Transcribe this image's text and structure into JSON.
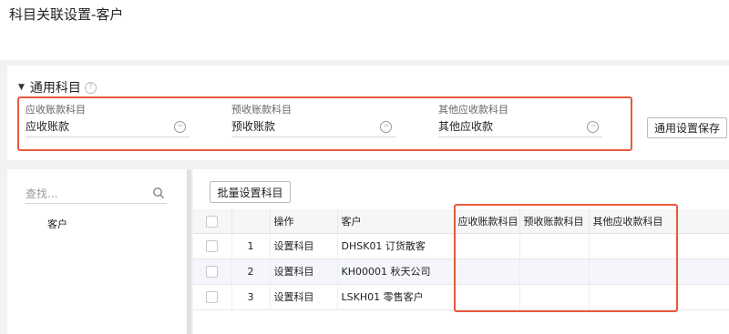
{
  "page": {
    "title": "科目关联设置-客户"
  },
  "general": {
    "section_title": "通用科目",
    "help_icon": "?",
    "fields": [
      {
        "label": "应收账款科目",
        "value": "应收账款"
      },
      {
        "label": "预收账款科目",
        "value": "预收账款"
      },
      {
        "label": "其他应收款科目",
        "value": "其他应收款"
      }
    ],
    "save_button": "通用设置保存"
  },
  "tree": {
    "search_placeholder": "查找...",
    "items": [
      "客户"
    ]
  },
  "grid": {
    "batch_button": "批量设置科目",
    "columns": [
      "",
      "",
      "操作",
      "客户",
      "应收账款科目",
      "预收账款科目",
      "其他应收款科目"
    ],
    "rows": [
      {
        "index": "1",
        "action": "设置科目",
        "customer": "DHSK01  订货散客"
      },
      {
        "index": "2",
        "action": "设置科目",
        "customer": "KH00001  秋天公司"
      },
      {
        "index": "3",
        "action": "设置科目",
        "customer": "LSKH01  零售客户"
      }
    ]
  },
  "colors": {
    "accent_link": "#3a68c8",
    "highlight": "#e8593c"
  }
}
